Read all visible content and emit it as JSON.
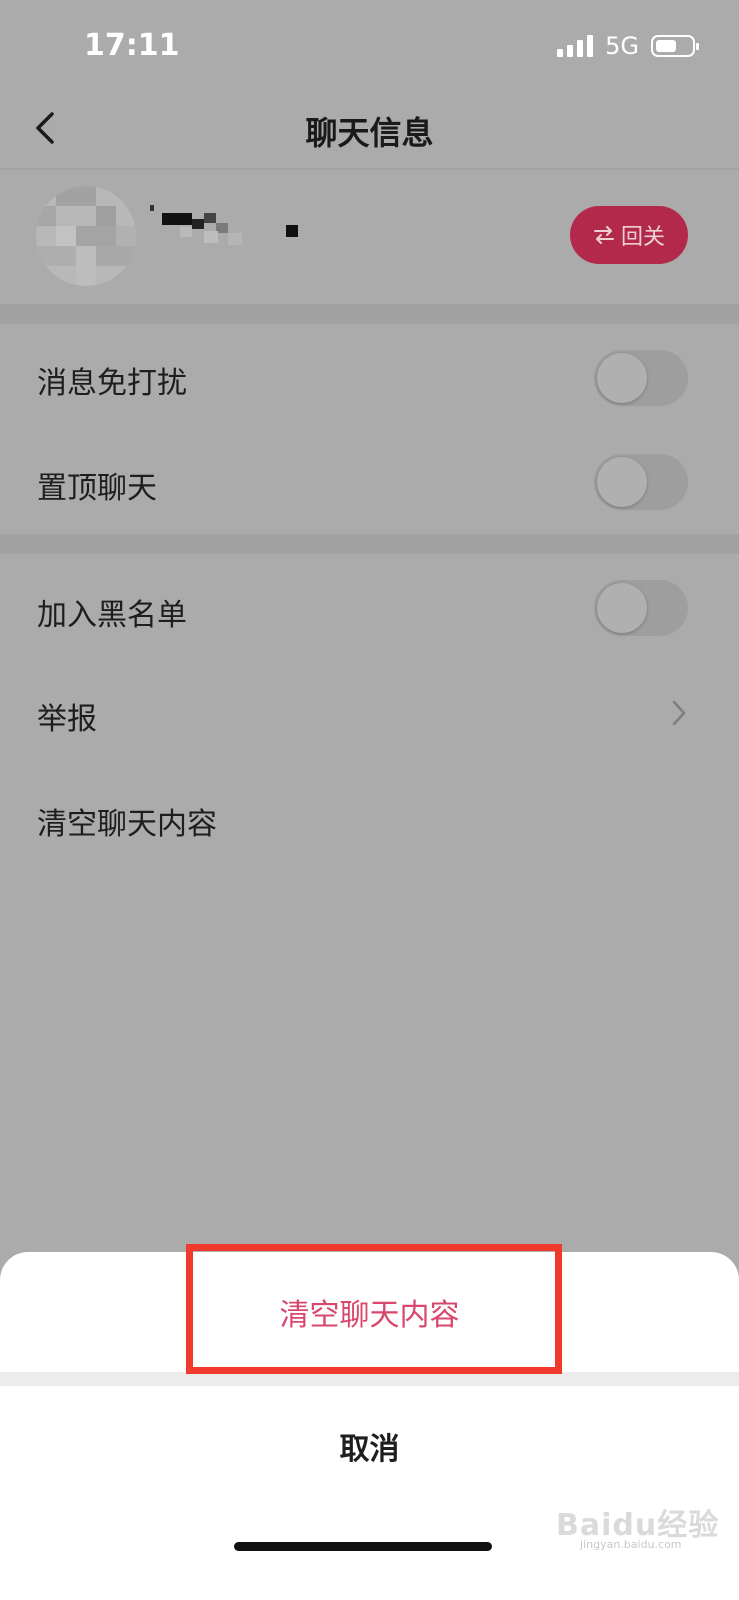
{
  "status_bar": {
    "time": "17:11",
    "network": "5G"
  },
  "header": {
    "title": "聊天信息"
  },
  "profile": {
    "follow_back_label": "回关",
    "follow_icon": "swap-arrows-icon"
  },
  "settings": {
    "mute": {
      "label": "消息免打扰",
      "on": false
    },
    "pin": {
      "label": "置顶聊天",
      "on": false
    },
    "block": {
      "label": "加入黑名单",
      "on": false
    },
    "report": {
      "label": "举报"
    },
    "clear": {
      "label": "清空聊天内容"
    }
  },
  "action_sheet": {
    "clear_label": "清空聊天内容",
    "cancel_label": "取消"
  },
  "watermark": {
    "brand": "Baidu经验",
    "url": "jingyan.baidu.com"
  },
  "colors": {
    "accent": "#b3294b",
    "sheet_action": "#d9476d",
    "highlight": "#f03a2c",
    "dim_background": "#ababab"
  }
}
